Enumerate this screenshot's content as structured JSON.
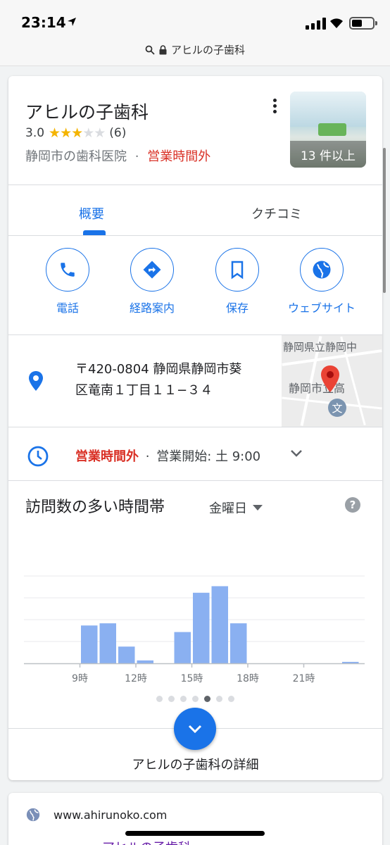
{
  "status_bar": {
    "time": "23:14"
  },
  "url_bar": {
    "text": "アヒルの子歯科"
  },
  "place": {
    "name": "アヒルの子歯科",
    "rating": "3.0",
    "stars_filled": 3,
    "stars_total": 5,
    "review_count": "(6)",
    "category": "静岡市の歯科医院",
    "separator": "·",
    "open_status": "営業時間外",
    "photo_label": "13 件以上"
  },
  "tabs": [
    {
      "label": "概要",
      "active": true
    },
    {
      "label": "クチコミ",
      "active": false
    }
  ],
  "actions": [
    {
      "label": "電話",
      "icon": "phone-icon"
    },
    {
      "label": "経路案内",
      "icon": "directions-icon"
    },
    {
      "label": "保存",
      "icon": "bookmark-icon"
    },
    {
      "label": "ウェブサイト",
      "icon": "globe-icon"
    }
  ],
  "address": {
    "line1": "〒420-0804 静岡県静岡市葵",
    "line2": "区竜南１丁目１１−３４"
  },
  "map": {
    "label1": "静岡県立静岡中",
    "label2": "静岡市立高",
    "school_glyph": "文"
  },
  "hours": {
    "status": "営業時間外",
    "sep": "·",
    "next": "営業開始: 土 9:00"
  },
  "popular_times": {
    "title": "訪問数の多い時間帯",
    "day": "金曜日",
    "help": "?"
  },
  "chart_data": {
    "type": "bar",
    "title": "訪問数の多い時間帯",
    "x": [
      6,
      7,
      8,
      9,
      10,
      11,
      12,
      13,
      14,
      15,
      16,
      17,
      18,
      19,
      20,
      21,
      22,
      23
    ],
    "values": [
      0,
      0,
      0,
      52,
      55,
      23,
      4,
      0,
      43,
      97,
      106,
      55,
      0,
      0,
      0,
      0,
      0,
      2
    ],
    "tick_labels": [
      "9時",
      "12時",
      "15時",
      "18時",
      "21時"
    ],
    "tick_hours": [
      9,
      12,
      15,
      18,
      21
    ],
    "ylim": [
      0,
      120
    ],
    "grid": true,
    "bar_color": "#8ab0f1"
  },
  "carousel": {
    "count": 7,
    "active_index": 4
  },
  "details_label": "アヒルの子歯科の詳細",
  "website": {
    "url": "www.ahirunoko.com",
    "peek": "アヒルの子歯科"
  },
  "colors": {
    "accent": "#1a73e8",
    "closed": "#d93025",
    "star": "#f4b400"
  }
}
